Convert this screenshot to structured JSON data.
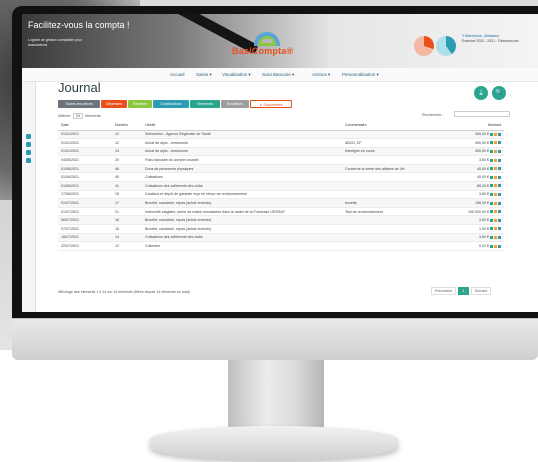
{
  "app": {
    "banner_title": "Facilitez-vous la compta !",
    "banner_sub": "Logiciel de gestion comptable pour associations",
    "logo_text": "BasiCompta®",
    "user_name": "Ÿ Bienvenue, Utilisateur",
    "user_line": "Exercice 2020 - 2021 · Déconnexion"
  },
  "nav": [
    "Accueil",
    "Saisie ▾",
    "Visualisation ▾",
    "Suivi Bancaire ▾",
    "Actions ▾",
    "Personnalisation ▾"
  ],
  "page": {
    "title": "Journal",
    "download_icon": "⤓",
    "search_icon": "🔍"
  },
  "filters": [
    {
      "label": "Toutes les pièces",
      "color": "#6c757d"
    },
    {
      "label": "Dépenses",
      "color": "#e94e1b"
    },
    {
      "label": "Recettes",
      "color": "#8cc63e"
    },
    {
      "label": "Contributions",
      "color": "#2c9cb3"
    },
    {
      "label": "Virements",
      "color": "#2aa68f"
    },
    {
      "label": "Brouillons",
      "color": "#9e9e9e"
    },
    {
      "label": "✕ Supprimées",
      "color": "#ffffff"
    }
  ],
  "list_controls": {
    "show_prefix": "Afficher",
    "show_value": "25",
    "show_suffix": "éléments",
    "search_label": "Rechercher :"
  },
  "table": {
    "headers": [
      "Date",
      "Numéro",
      "Libellé",
      "Commentaire",
      "Montant"
    ],
    "rows": [
      [
        "01/01/2021",
        "12",
        "Subvention - Agence Régionale de Santé",
        "",
        "450,00 €"
      ],
      [
        "01/01/2021",
        "12",
        "Achat de stylo - remboursé",
        "ABCD, EF",
        "450,00 €"
      ],
      [
        "01/01/2021",
        "13",
        "Achat de stylo - remboursé",
        "Interligne en cours",
        "350,00 €"
      ],
      [
        "04/05/2021",
        "20",
        "Frais bancaire du compte courant",
        "",
        "3,60 €"
      ],
      [
        "01/06/2021",
        "46",
        "Dons de personnes physiques",
        "Concerne la vente des affaires de Jef",
        "40,00 €"
      ],
      [
        "01/06/2021",
        "46",
        "Cotisations",
        "",
        "40,00 €"
      ],
      [
        "01/06/2021",
        "41",
        "Cotisations des adhérents des clubs",
        "",
        "-56,20 €"
      ],
      [
        "17/06/2021",
        "15",
        "Cautions et dépôt de garantie reçu en retour de remboursement",
        "",
        "3,60 €"
      ],
      [
        "01/07/2021",
        "17",
        "Buvette, sandwich, repas (achat revendu)",
        "buvette",
        "156,00 €"
      ],
      [
        "01/07/2021",
        "21",
        "Indemnité stagiaire, prime de match encaissées dans le cadre de la Franchise URSSAF",
        "Test de remboursement",
        "100 000,00 €"
      ],
      [
        "06/07/2021",
        "16",
        "Buvette, sandwich, repas (achat revendu)",
        "",
        "3,60 €"
      ],
      [
        "07/07/2021",
        "16",
        "Buvette, sandwich, repas (achat revendu)",
        "",
        "1,00 €"
      ],
      [
        "18/07/2021",
        "14",
        "Cotisations des adhérents des clubs",
        "",
        "3,60 €"
      ],
      [
        "22/07/2021",
        "12",
        "Collectes",
        "",
        "0,22 €"
      ]
    ]
  },
  "footer": {
    "info": "Affichage des éléments 1 à 14 sur 14 éléments (filtrés depuis 14 éléments au total)",
    "prev": "Précédent",
    "page": "1",
    "next": "Suivant"
  }
}
